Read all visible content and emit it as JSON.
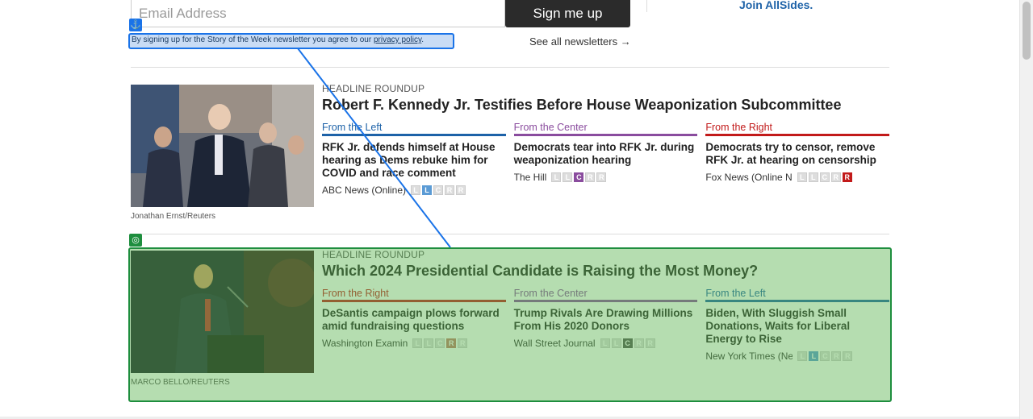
{
  "newsletter": {
    "email_placeholder": "Email Address",
    "signup_label": "Sign me up",
    "join_label": "Join AllSides.",
    "terms_text": "By signing up for the Story of the Week newsletter you agree to our ",
    "terms_link": "privacy policy",
    "terms_end": ".",
    "see_all_label": "See all newsletters →"
  },
  "stories": [
    {
      "kicker": "HEADLINE ROUNDUP",
      "headline": "Robert F. Kennedy Jr. Testifies Before House Weaponization Subcommittee",
      "caption": "Jonathan Ernst/Reuters",
      "columns": [
        {
          "label": "From the Left",
          "title": "RFK Jr. defends himself at House hearing as Dems rebuke him for COVID and race comment",
          "source": "ABC News (Online)",
          "bias": "L"
        },
        {
          "label": "From the Center",
          "title": "Democrats tear into RFK Jr. during weaponization hearing",
          "source": "The Hill",
          "bias": "C"
        },
        {
          "label": "From the Right",
          "title": "Democrats try to censor, remove RFK Jr. at hearing on censorship",
          "source": "Fox News (Online N",
          "bias": "R"
        }
      ]
    },
    {
      "kicker": "HEADLINE ROUNDUP",
      "headline": "Which 2024 Presidential Candidate is Raising the Most Money?",
      "caption": "MARCO BELLO/REUTERS",
      "columns": [
        {
          "label": "From the Right",
          "title": "DeSantis campaign plows forward amid fundraising questions",
          "source": "Washington Examin",
          "bias": "R"
        },
        {
          "label": "From the Center",
          "title": "Trump Rivals Are Drawing Millions From His 2020 Donors",
          "source": "Wall Street Journal",
          "bias": "C"
        },
        {
          "label": "From the Left",
          "title": "Biden, With Sluggish Small Donations, Waits for Liberal Energy to Rise",
          "source": "New York Times (Ne",
          "bias": "L"
        }
      ]
    }
  ],
  "bias_letters": [
    "L",
    "L",
    "C",
    "R",
    "R"
  ],
  "colors": {
    "left": "#1d62a8",
    "center": "#8a4c9e",
    "right": "#c21a1a",
    "anchor": "#1a73e8",
    "target": "#1e8e3e"
  },
  "icons": {
    "anchor": "anchor-icon",
    "target": "target-icon"
  }
}
